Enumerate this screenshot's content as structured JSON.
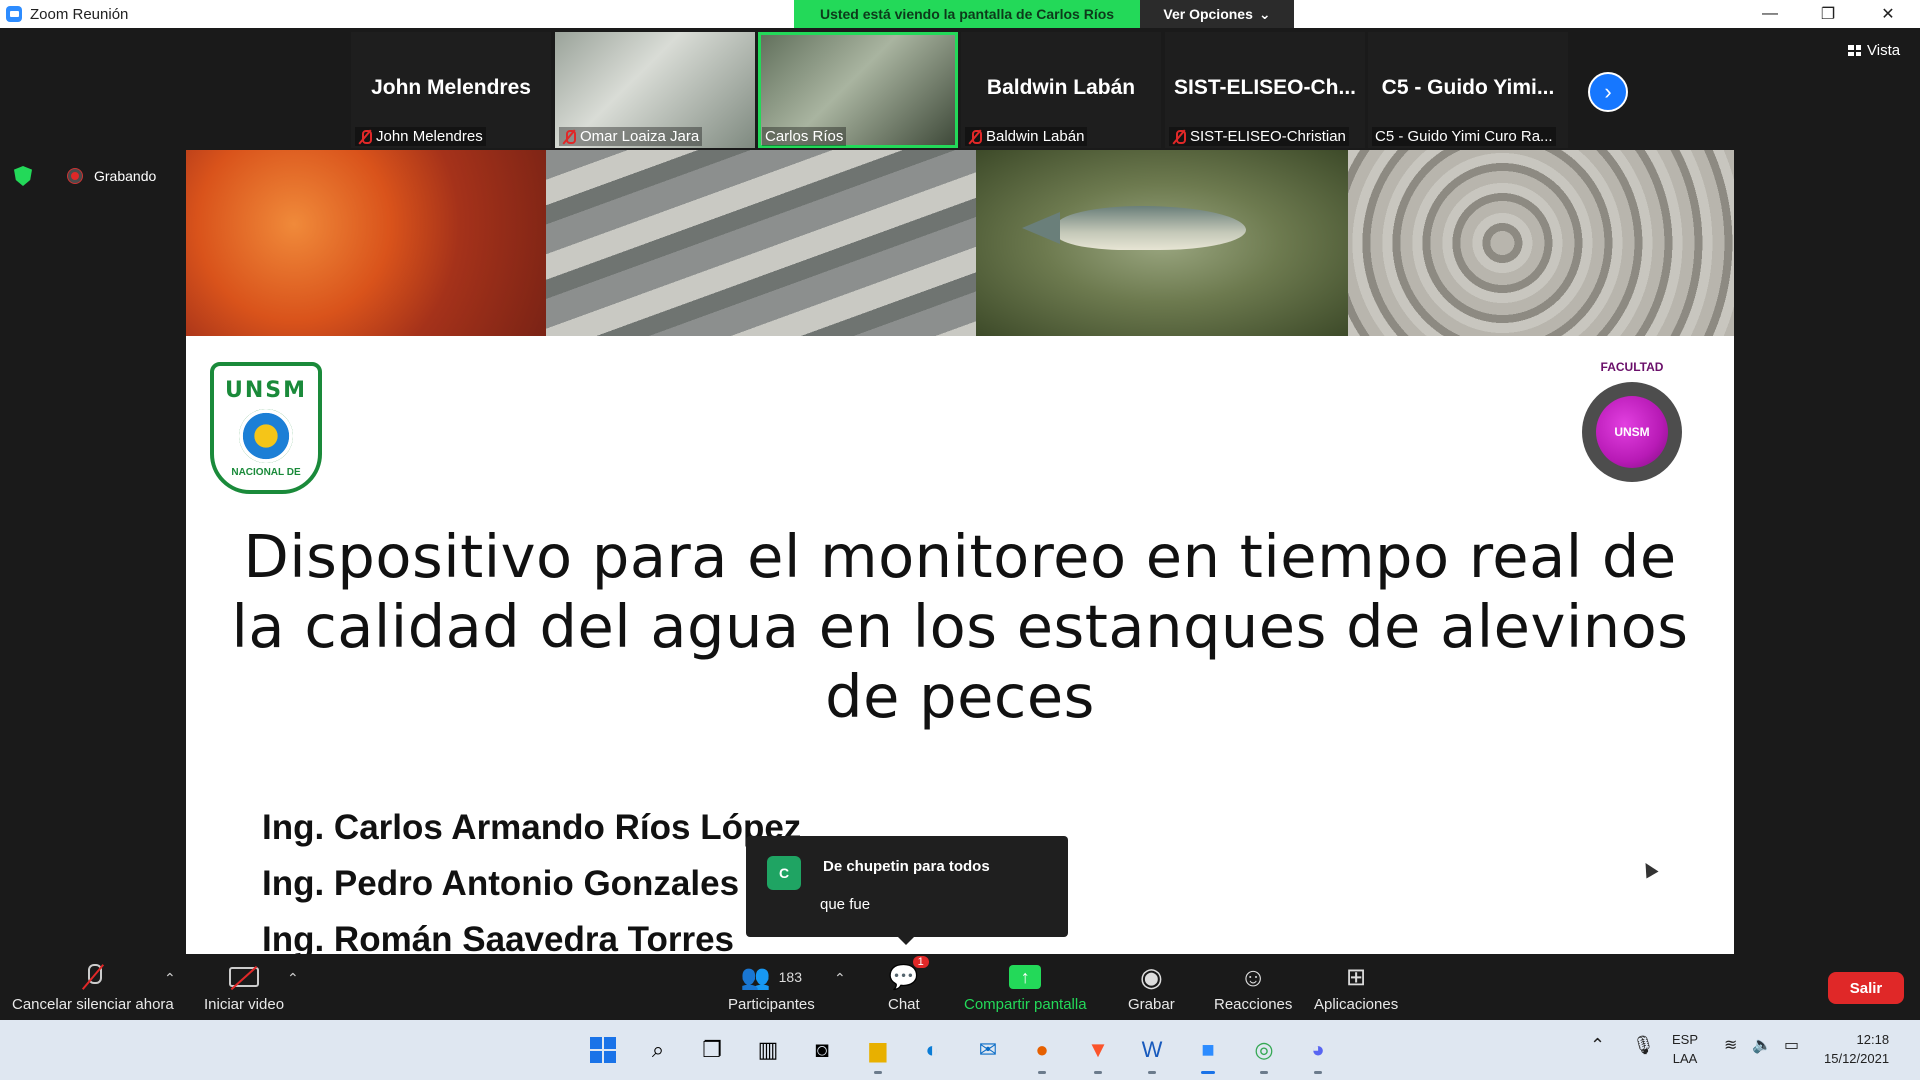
{
  "window": {
    "title": "Zoom Reunión",
    "share_banner": "Usted está viendo la pantalla de Carlos Ríos",
    "view_options": "Ver Opciones",
    "minimize": "—",
    "maximize": "❐",
    "close": "✕"
  },
  "gallery": {
    "tiles": [
      {
        "big": "John Melendres",
        "small": "John Melendres",
        "muted": true,
        "video": false
      },
      {
        "big": "",
        "small": "Omar Loaiza Jara",
        "muted": true,
        "video": true
      },
      {
        "big": "",
        "small": "Carlos Ríos",
        "muted": false,
        "video": true
      },
      {
        "big": "Baldwin Labán",
        "small": "Baldwin Labán",
        "muted": true,
        "video": false
      },
      {
        "big": "SIST-ELISEO-Ch...",
        "small": "SIST-ELISEO-Christian",
        "muted": true,
        "video": false
      },
      {
        "big": "C5 - Guido Yimi...",
        "small": "C5 - Guido Yimi Curo Ra...",
        "muted": false,
        "video": false
      }
    ],
    "next_icon": "›",
    "view_label": "Vista"
  },
  "recording": {
    "label": "Grabando"
  },
  "slide": {
    "left_logo_top": "UNSM",
    "left_logo_bottom": "NACIONAL DE",
    "right_logo_top": "FACULTAD",
    "right_logo_center": "UNSM",
    "title": "Dispositivo para el monitoreo en tiempo real de la calidad del agua en los estanques de alevinos de peces",
    "authors": [
      "Ing. Carlos Armando Ríos López",
      "Ing. Pedro Antonio Gonzales S",
      "Ing. Román Saavedra Torres"
    ]
  },
  "chat_popup": {
    "avatar_letter": "C",
    "sender": "De chupetin para todos",
    "message": "que fue"
  },
  "toolbar": {
    "unmute_label": "Cancelar silenciar ahora",
    "video_label": "Iniciar video",
    "participants_count": "183",
    "participants_label": "Participantes",
    "chat_label": "Chat",
    "chat_badge": "1",
    "share_label": "Compartir pantalla",
    "record_label": "Grabar",
    "reactions_label": "Reacciones",
    "apps_label": "Aplicaciones",
    "leave_label": "Salir"
  },
  "taskbar": {
    "language_top": "ESP",
    "language_bottom": "LAA",
    "time": "12:18",
    "date": "15/12/2021"
  }
}
